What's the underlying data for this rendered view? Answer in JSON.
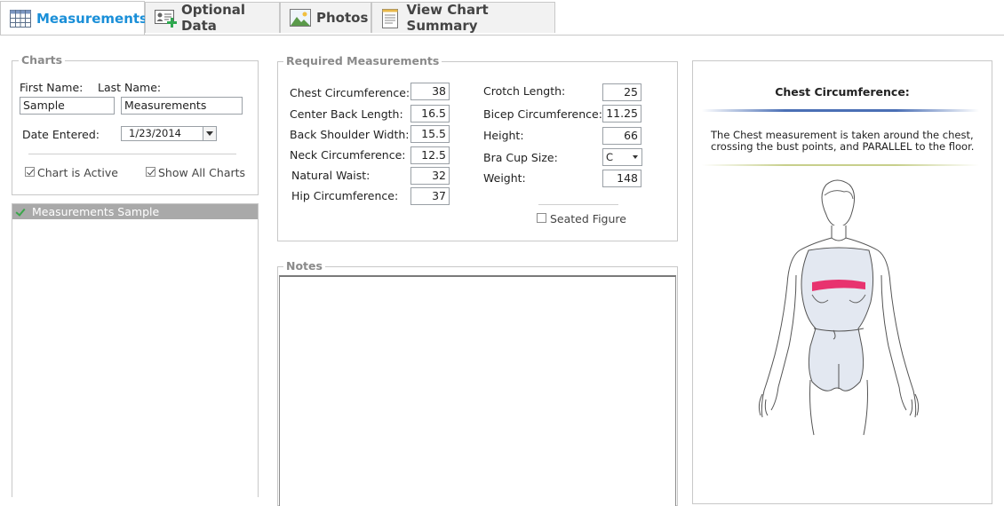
{
  "tabs": [
    {
      "label": "Measurements",
      "icon": "grid-icon"
    },
    {
      "label": "Optional Data",
      "icon": "contact-card-icon"
    },
    {
      "label": "Photos",
      "icon": "image-icon"
    },
    {
      "label": "View Chart Summary",
      "icon": "document-icon"
    }
  ],
  "charts": {
    "legend": "Charts",
    "first_name_label": "First Name:",
    "last_name_label": "Last Name:",
    "first_name_value": "Sample",
    "last_name_value": "Measurements",
    "date_label": "Date Entered:",
    "date_value": "1/23/2014",
    "chart_active_label": "Chart is Active",
    "show_all_label": "Show All Charts",
    "list": [
      "Measurements Sample"
    ]
  },
  "required": {
    "legend": "Required Measurements",
    "left": [
      {
        "label": "Chest Circumference:",
        "value": "38"
      },
      {
        "label": "Center Back Length:",
        "value": "16.5"
      },
      {
        "label": "Back Shoulder Width:",
        "value": "15.5"
      },
      {
        "label": "Neck Circumference:",
        "value": "12.5"
      },
      {
        "label": "Natural Waist:",
        "value": "32"
      },
      {
        "label": "Hip Circumference:",
        "value": "37"
      }
    ],
    "right": [
      {
        "label": "Crotch Length:",
        "value": "25"
      },
      {
        "label": "Bicep Circumference:",
        "value": "11.25"
      },
      {
        "label": "Height:",
        "value": "66"
      },
      {
        "label": "Bra Cup Size:",
        "value": "C"
      },
      {
        "label": "Weight:",
        "value": "148"
      }
    ],
    "seated_label": "Seated Figure"
  },
  "notes": {
    "legend": "Notes"
  },
  "info": {
    "title": "Chest Circumference:",
    "description": "The Chest measurement is taken around the chest, crossing the bust points, and PARALLEL to the floor.",
    "highlight_color": "#e8336f"
  },
  "colors": {
    "accent": "#1a8fd8",
    "selection_bg": "#a9a9a9"
  }
}
